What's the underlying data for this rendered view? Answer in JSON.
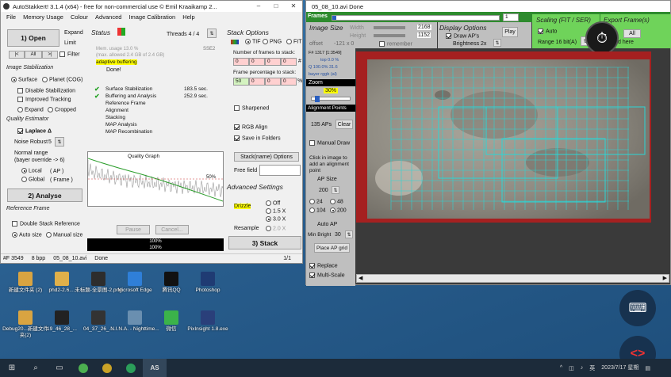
{
  "left_window": {
    "title": "AutoStakkert! 3.1.4 (x64) - free for non-commercial use © Emil Kraaikamp 2...",
    "menu": [
      "File",
      "Memory Usage",
      "Colour",
      "Advanced",
      "Image Calibration",
      "Help"
    ],
    "open_label": "1) Open",
    "expand": "Expand",
    "limit": "Limit",
    "nav": [
      "|<",
      "All",
      ">|"
    ],
    "filter": "Filter",
    "stab_title": "Image Stabilization",
    "surface": "Surface",
    "planet": "Planet (COG)",
    "disable_stab": "Disable Stabilization",
    "improved": "Improved Tracking",
    "expand2": "Expand",
    "cropped": "Cropped",
    "qe_title": "Quality Estimator",
    "laplace": "Laplace Δ",
    "noise": "Noise Robust",
    "noise_val": "5",
    "normal_range": "Normal range",
    "bayer_override": "(bayer override -> 6)",
    "local": "Local",
    "local_ap": "( AP )",
    "global": "Global",
    "global_frame": "( Frame )",
    "analyse": "2) Analyse",
    "rf_title": "Reference Frame",
    "double_stack": "Double Stack Reference",
    "autosize": "Auto size",
    "manual_size": "Manual size",
    "status_title": "Status",
    "threads": "Threads 4 / 4",
    "mem": "Mem. usage 13.0 %",
    "mem2": "(max. allowed 2.4 GB of 2.4 GB)",
    "adaptive": "adaptive buffering",
    "sse": "SSE2",
    "done": "Done!",
    "steps": [
      {
        "name": "Surface Stabilization",
        "time": "183.5 sec."
      },
      {
        "name": "Buffering and Analysis",
        "time": "252.9 sec."
      },
      {
        "name": "Reference Frame",
        "time": ""
      },
      {
        "name": "Alignment",
        "time": ""
      },
      {
        "name": "Stacking",
        "time": ""
      },
      {
        "name": "MAP Analysis",
        "time": ""
      },
      {
        "name": "MAP Recombination",
        "time": ""
      }
    ],
    "quality_graph": "Quality Graph",
    "qg_pct": "50%",
    "pause": "Pause",
    "cancel": "Cancel...",
    "prog1": "100%",
    "prog2": "100%",
    "stack_title": "Stack Options",
    "tif": "TIF",
    "png": "PNG",
    "fit": "FIT",
    "frames_to_stack": "Number of frames to stack:",
    "frames_vals": [
      "0",
      "0",
      "0",
      "0"
    ],
    "hash": "#",
    "pct_to_stack": "Frame percentage to stack:",
    "pct_vals": [
      "50",
      "0",
      "0",
      "0"
    ],
    "pct": "%",
    "sharpened": "Sharpened",
    "rgb_align": "RGB Align",
    "save_folders": "Save in Folders",
    "stackname": "Stack(name) Options",
    "freefield": "Free field",
    "adv_title": "Advanced Settings",
    "drizzle": "Drizzle",
    "off": "Off",
    "x15": "1.5 X",
    "x30": "3.0 X",
    "resample": "Resample",
    "x20": "2.0 X",
    "stack_btn": "3) Stack",
    "status": {
      "frame": "#F 3549",
      "bpp": "8 bpp",
      "file": "05_08_10.avi",
      "state": "Done",
      "page": "1/1"
    }
  },
  "right_window": {
    "title": "05_08_10.avi   Done",
    "frames": "Frames",
    "frame_val": "1",
    "img_size": "Image Size",
    "width": "Width",
    "w_val": "2168",
    "height": "Height",
    "h_val": "1152",
    "offset": "offset",
    "offset_val": "-121 x 0",
    "remember": "remember",
    "display": "Display Options",
    "draw_aps": "Draw AP's",
    "play": "Play",
    "brightness": "Brightness 2x",
    "scaling": "Scaling (FIT / SER)",
    "auto": "Auto",
    "range": "Range 16 bit(A)",
    "export": "Export Frame(s)",
    "all": "All",
    "xhere": "d here",
    "info1": "F# 1317 [1:3549]",
    "info2": "top 0.0 %",
    "info3": "Q 100.0%  31.6",
    "info4": "bayer rggb (al)",
    "zoom": "Zoom",
    "zoom_val": "30%",
    "ap_title": "Alignment Points",
    "aps": "135 APs",
    "clear": "Clear",
    "manual_draw": "Manual Draw",
    "click_hint": "Click in image to add an alignment point",
    "ap_size": "AP Size",
    "size_val": "200",
    "s24": "24",
    "s48": "48",
    "s104": "104",
    "s200": "200",
    "auto_ap": "Auto AP",
    "min_bright": "Min Bright",
    "mb_val": "30",
    "place": "Place AP grid",
    "replace": "Replace",
    "multiscale": "Multi-Scale"
  },
  "desktop_icons": [
    {
      "label": "新建文件夹 (2)"
    },
    {
      "label": "phd2-2.6...."
    },
    {
      "label": "未标题-全景图-2.png"
    },
    {
      "label": "Microsoft Edge"
    },
    {
      "label": "腾讯QQ"
    },
    {
      "label": "Photoshop"
    },
    {
      "label": "Debug20...新建文件夹(2)"
    },
    {
      "label": "19_46_28_..."
    },
    {
      "label": "04_37_26_..."
    },
    {
      "label": "N.I.N.A. - Nighttime..."
    },
    {
      "label": "微信"
    },
    {
      "label": "PixInsight 1.8.exe"
    }
  ],
  "taskbar": {
    "time": "",
    "date": "2023/7/17 星期",
    "lang": "英"
  },
  "colors": {
    "accent": "#28a428",
    "drizzle": "#ffff00",
    "cyan": "#2bd6d6"
  }
}
